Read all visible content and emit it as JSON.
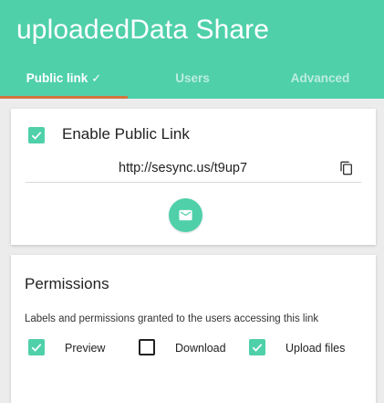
{
  "header": {
    "title": "uploadedData Share",
    "background": "#4fd0a9"
  },
  "tabs": [
    {
      "label": "Public link",
      "active": true,
      "check": "✓"
    },
    {
      "label": "Users",
      "active": false
    },
    {
      "label": "Advanced",
      "active": false
    }
  ],
  "public_link": {
    "enable_label": "Enable Public Link",
    "enabled": true,
    "url": "http://sesync.us/t9up7",
    "copy_icon": "copy-icon",
    "email_icon": "email-icon"
  },
  "permissions": {
    "heading": "Permissions",
    "description": "Labels and permissions granted to the users accessing this link",
    "items": [
      {
        "label": "Preview",
        "checked": true
      },
      {
        "label": "Download",
        "checked": false
      },
      {
        "label": "Upload files",
        "checked": true
      }
    ]
  },
  "colors": {
    "accent": "#4fd0a9",
    "tab_indicator": "#d1743f"
  }
}
